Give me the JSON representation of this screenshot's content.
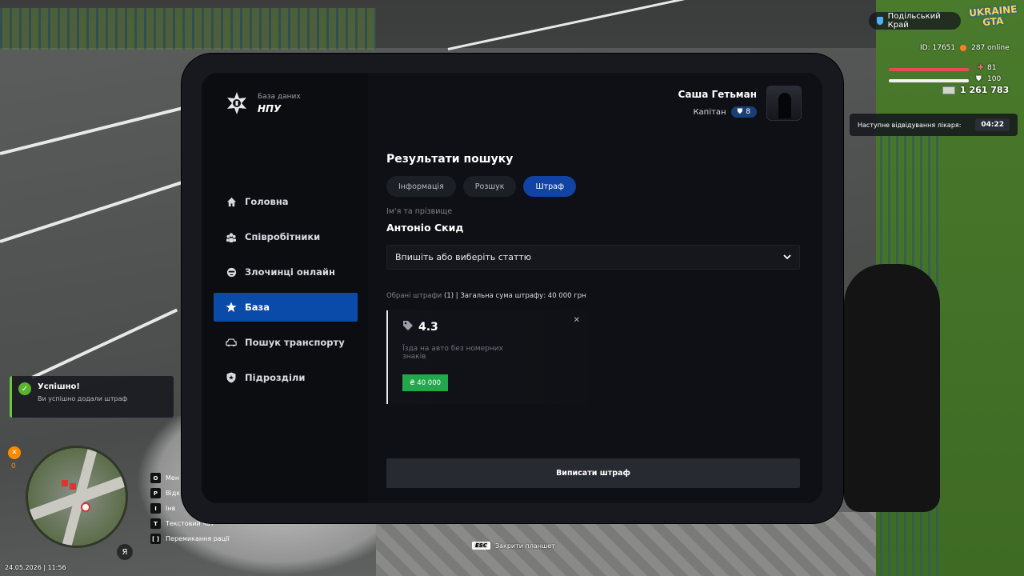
{
  "hud": {
    "server_name": "Подільський Край",
    "logo_text": "UKRAINE GTA",
    "player_id": "ID: 17651",
    "online": "287 online",
    "health": "81",
    "armor": "100",
    "money": "1 261 783",
    "doctor_label": "Наступне відвідування лікаря:",
    "doctor_time": "04:22",
    "datetime": "24.05.2026 | 11:56",
    "minimap_count": "0",
    "mic_label": "Я"
  },
  "notification": {
    "title": "Успішно!",
    "message": "Ви успішно додали штраф"
  },
  "keybinds": [
    {
      "key": "O",
      "label": "Мен"
    },
    {
      "key": "P",
      "label": "Відк"
    },
    {
      "key": "I",
      "label": "Інв"
    },
    {
      "key": "T",
      "label": "Текстовий чат"
    },
    {
      "key": "[ ]",
      "label": "Перемикання рації"
    }
  ],
  "esc_hint": {
    "key": "ESC",
    "label": "Закрити планшет"
  },
  "tablet": {
    "brand_sub": "База даних",
    "brand_name": "НПУ",
    "user": {
      "name": "Саша Гетьман",
      "rank": "Капітан",
      "level": "8"
    },
    "nav": [
      {
        "label": "Головна",
        "icon": "home-icon"
      },
      {
        "label": "Співробітники",
        "icon": "people-icon"
      },
      {
        "label": "Злочинці онлайн",
        "icon": "criminal-icon"
      },
      {
        "label": "База",
        "icon": "star-icon"
      },
      {
        "label": "Пошук транспорту",
        "icon": "car-icon"
      },
      {
        "label": "Підрозділи",
        "icon": "shield-icon"
      }
    ],
    "heading": "Результати пошуку",
    "tabs": [
      "Інформація",
      "Розшук",
      "Штраф"
    ],
    "active_tab": "Штраф",
    "name_label": "Ім'я та прізвище",
    "name_value": "Антоніо Скид",
    "article_select_placeholder": "Впишіть або виберіть статтю",
    "summary_label": "Обрані штрафи",
    "summary_count": "(1)",
    "summary_total": "| Загальна сума штрафу: 40 000 грн",
    "fine": {
      "code": "4.3",
      "description": "Їзда на авто без номерних знаків",
      "amount": "₴ 40 000"
    },
    "submit_label": "Виписати штраф"
  },
  "colors": {
    "accent": "#0a4aa8",
    "tab_active": "#1043a3",
    "money": "#21a84a",
    "success": "#59b52d"
  }
}
